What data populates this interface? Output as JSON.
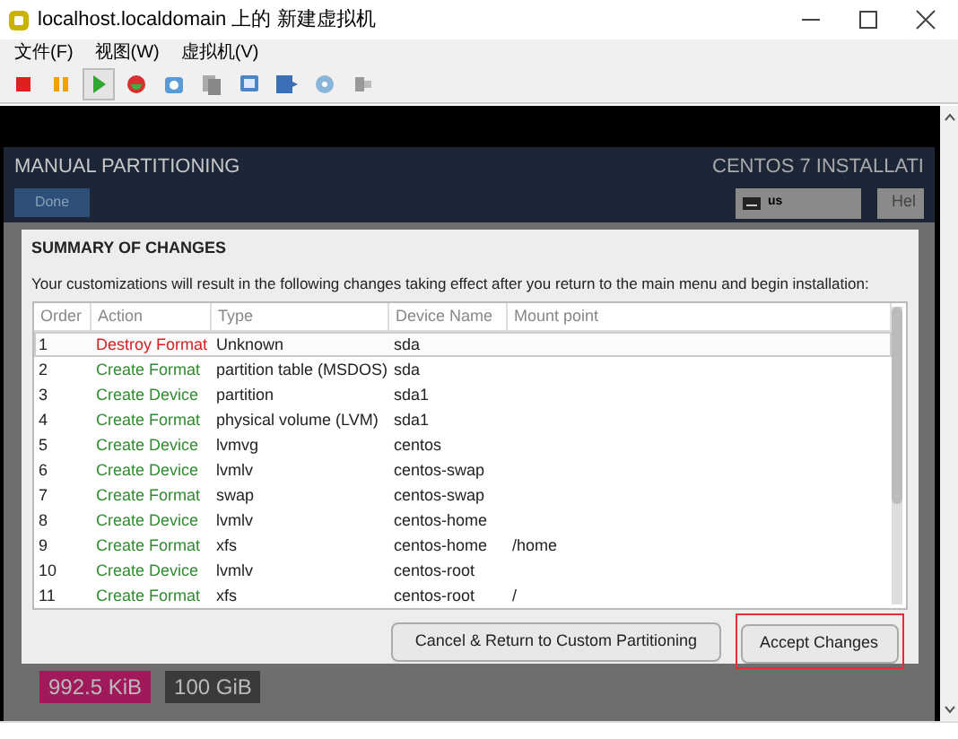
{
  "window": {
    "title": "localhost.localdomain 上的 新建虚拟机"
  },
  "menu": [
    "文件(F)",
    "视图(W)",
    "虚拟机(V)"
  ],
  "toolbar": [
    {
      "kind": "stop",
      "pressed": false
    },
    {
      "kind": "pause",
      "pressed": false
    },
    {
      "kind": "play",
      "pressed": true
    },
    {
      "kind": "reset",
      "pressed": false
    },
    {
      "kind": "snapshot",
      "pressed": false
    },
    {
      "kind": "clone",
      "pressed": false
    },
    {
      "kind": "console",
      "pressed": false
    },
    {
      "kind": "send",
      "pressed": false
    },
    {
      "kind": "disk",
      "pressed": false
    },
    {
      "kind": "usb",
      "pressed": false
    }
  ],
  "installer": {
    "title": "MANUAL PARTITIONING",
    "done_button": "Done",
    "product": "CENTOS 7 INSTALLATI",
    "keyboard": "us",
    "help_button": "Hel",
    "badges": [
      {
        "label": "992.5 KiB",
        "color": "#a0195a"
      },
      {
        "label": "100 GiB",
        "color": "#3a3a3a"
      }
    ]
  },
  "dialog": {
    "title": "SUMMARY OF CHANGES",
    "description": "Your customizations will result in the following changes taking effect after you return to the main menu and begin installation:",
    "columns": [
      "Order",
      "Action",
      "Type",
      "Device Name",
      "Mount point"
    ],
    "rows": [
      {
        "order": "1",
        "action": "Destroy Format",
        "kind": "destroy",
        "type": "Unknown",
        "device": "sda",
        "selected": true
      },
      {
        "order": "2",
        "action": "Create Format",
        "kind": "create",
        "type": "partition table (MSDOS)",
        "device": "sda",
        "selected": false
      },
      {
        "order": "3",
        "action": "Create Device",
        "kind": "create",
        "type": "partition",
        "device": "sda1",
        "selected": false
      },
      {
        "order": "4",
        "action": "Create Format",
        "kind": "create",
        "type": "physical volume (LVM)",
        "device": "sda1",
        "selected": false
      },
      {
        "order": "5",
        "action": "Create Device",
        "kind": "create",
        "type": "lvmvg",
        "device": "centos",
        "selected": false
      },
      {
        "order": "6",
        "action": "Create Device",
        "kind": "create",
        "type": "lvmlv",
        "device": "centos-swap",
        "selected": false
      },
      {
        "order": "7",
        "action": "Create Format",
        "kind": "create",
        "type": "swap",
        "device": "centos-swap",
        "selected": false
      },
      {
        "order": "8",
        "action": "Create Device",
        "kind": "create",
        "type": "lvmlv",
        "device": "centos-home",
        "selected": false
      },
      {
        "order": "9",
        "action": "Create Format",
        "kind": "create",
        "type": "xfs",
        "device": "centos-home",
        "mount": "/home",
        "selected": false
      },
      {
        "order": "10",
        "action": "Create Device",
        "kind": "create",
        "type": "lvmlv",
        "device": "centos-root",
        "selected": false
      },
      {
        "order": "11",
        "action": "Create Format",
        "kind": "create",
        "type": "xfs",
        "device": "centos-root",
        "mount": "/",
        "selected": false
      }
    ],
    "cancel_button": "Cancel & Return to Custom Partitioning",
    "accept_button": {
      "label": "Accept Changes",
      "highlighted": true
    }
  }
}
